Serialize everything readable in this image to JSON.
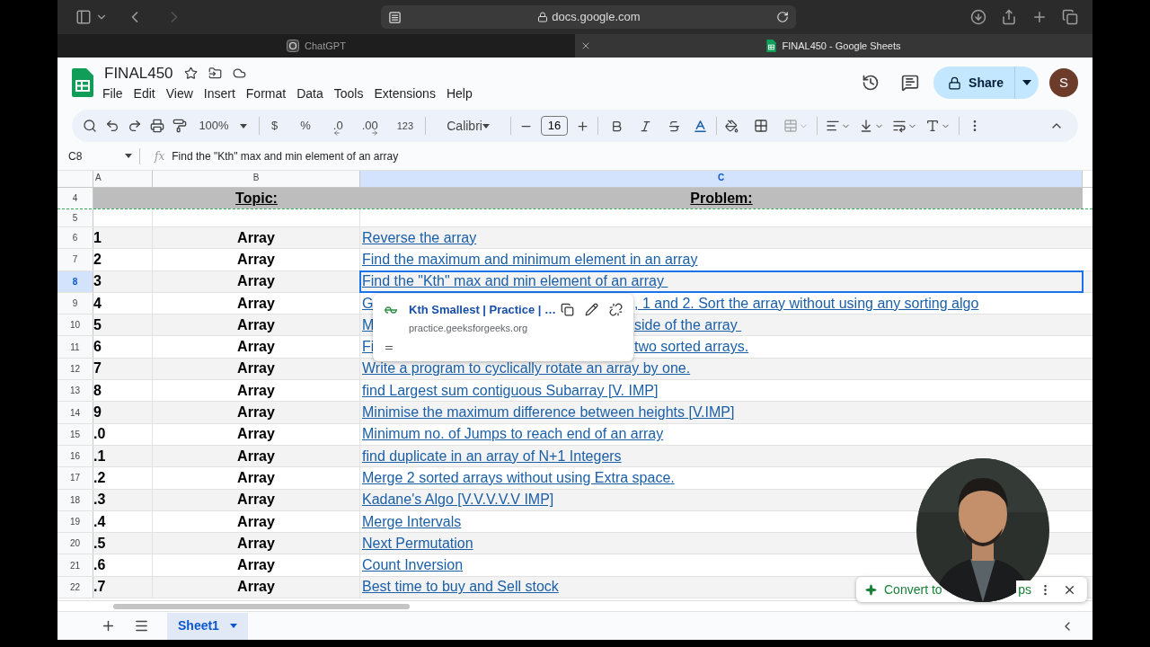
{
  "browser": {
    "url": "docs.google.com",
    "tabs": [
      {
        "title": "ChatGPT",
        "selected": false
      },
      {
        "title": "FINAL450 - Google Sheets",
        "selected": true
      }
    ]
  },
  "doc": {
    "title": "FINAL450",
    "menu": [
      "File",
      "Edit",
      "View",
      "Insert",
      "Format",
      "Data",
      "Tools",
      "Extensions",
      "Help"
    ],
    "share": "Share",
    "avatar": "S"
  },
  "toolbar": {
    "zoom": "100%",
    "currency": "$",
    "percent": "%",
    "decimal_decrease": ".0",
    "decimal_increase": ".00",
    "number_format": "123",
    "font": "Calibri",
    "font_size": "16"
  },
  "formula_bar": {
    "cell": "C8",
    "fx": "fx",
    "content": "Find the \"Kth\" max and min element of an array"
  },
  "columns": [
    {
      "letter": "A",
      "selected": false
    },
    {
      "letter": "B",
      "selected": false
    },
    {
      "letter": "C",
      "selected": true
    }
  ],
  "header_row": {
    "number": "4",
    "topic": "Topic:",
    "problem": "Problem:"
  },
  "rows": [
    {
      "number": "5",
      "selected": false
    },
    {
      "number": "6",
      "index": "1",
      "topic": "Array",
      "problem": "Reverse the array",
      "selected": false
    },
    {
      "number": "7",
      "index": "2",
      "topic": "Array",
      "problem": "Find the maximum and minimum element in an array",
      "selected": false
    },
    {
      "number": "8",
      "index": "3",
      "topic": "Array",
      "problem": "Find the \"Kth\" max and min element of an array ",
      "selected": true
    },
    {
      "number": "9",
      "index": "4",
      "topic": "Array",
      "problem_start": "G",
      "problem_end": ", 1 and 2. Sort the array without using any sorting algo",
      "selected": false
    },
    {
      "number": "10",
      "index": "5",
      "topic": "Array",
      "problem_start": "M",
      "problem_end": "side of the array ",
      "selected": false
    },
    {
      "number": "11",
      "index": "6",
      "topic": "Array",
      "problem_start": "Fi",
      "problem_end": "two sorted arrays.",
      "selected": false
    },
    {
      "number": "12",
      "index": "7",
      "topic": "Array",
      "problem": "Write a program to cyclically rotate an array by one.",
      "selected": false
    },
    {
      "number": "13",
      "index": "8",
      "topic": "Array",
      "problem": "find Largest sum contiguous Subarray [V. IMP]",
      "selected": false
    },
    {
      "number": "14",
      "index": "9",
      "topic": "Array",
      "problem": "Minimise the maximum difference between heights [V.IMP]",
      "selected": false
    },
    {
      "number": "15",
      "index": ".0",
      "topic": "Array",
      "problem": "Minimum no. of Jumps to reach end of an array",
      "selected": false
    },
    {
      "number": "16",
      "index": ".1",
      "topic": "Array",
      "problem": "find duplicate in an array of N+1 Integers",
      "selected": false
    },
    {
      "number": "17",
      "index": ".2",
      "topic": "Array",
      "problem": "Merge 2 sorted arrays without using Extra space.",
      "selected": false
    },
    {
      "number": "18",
      "index": ".3",
      "topic": "Array",
      "problem": "Kadane's Algo [V.V.V.V.V IMP]",
      "selected": false
    },
    {
      "number": "19",
      "index": ".4",
      "topic": "Array",
      "problem": "Merge Intervals",
      "selected": false
    },
    {
      "number": "20",
      "index": ".5",
      "topic": "Array",
      "problem": "Next Permutation",
      "selected": false
    },
    {
      "number": "21",
      "index": ".6",
      "topic": "Array",
      "problem": "Count Inversion",
      "selected": false
    },
    {
      "number": "22",
      "index": ".7",
      "topic": "Array",
      "problem": "Best time to buy and Sell stock",
      "selected": false
    }
  ],
  "link_popup": {
    "title": "Kth Smallest | Practice | …",
    "url": "practice.geeksforgeeks.org"
  },
  "sheets": [
    {
      "name": "Sheet1",
      "selected": true
    }
  ],
  "chip": {
    "label_start": "Convert to",
    "label_end": "ps"
  }
}
